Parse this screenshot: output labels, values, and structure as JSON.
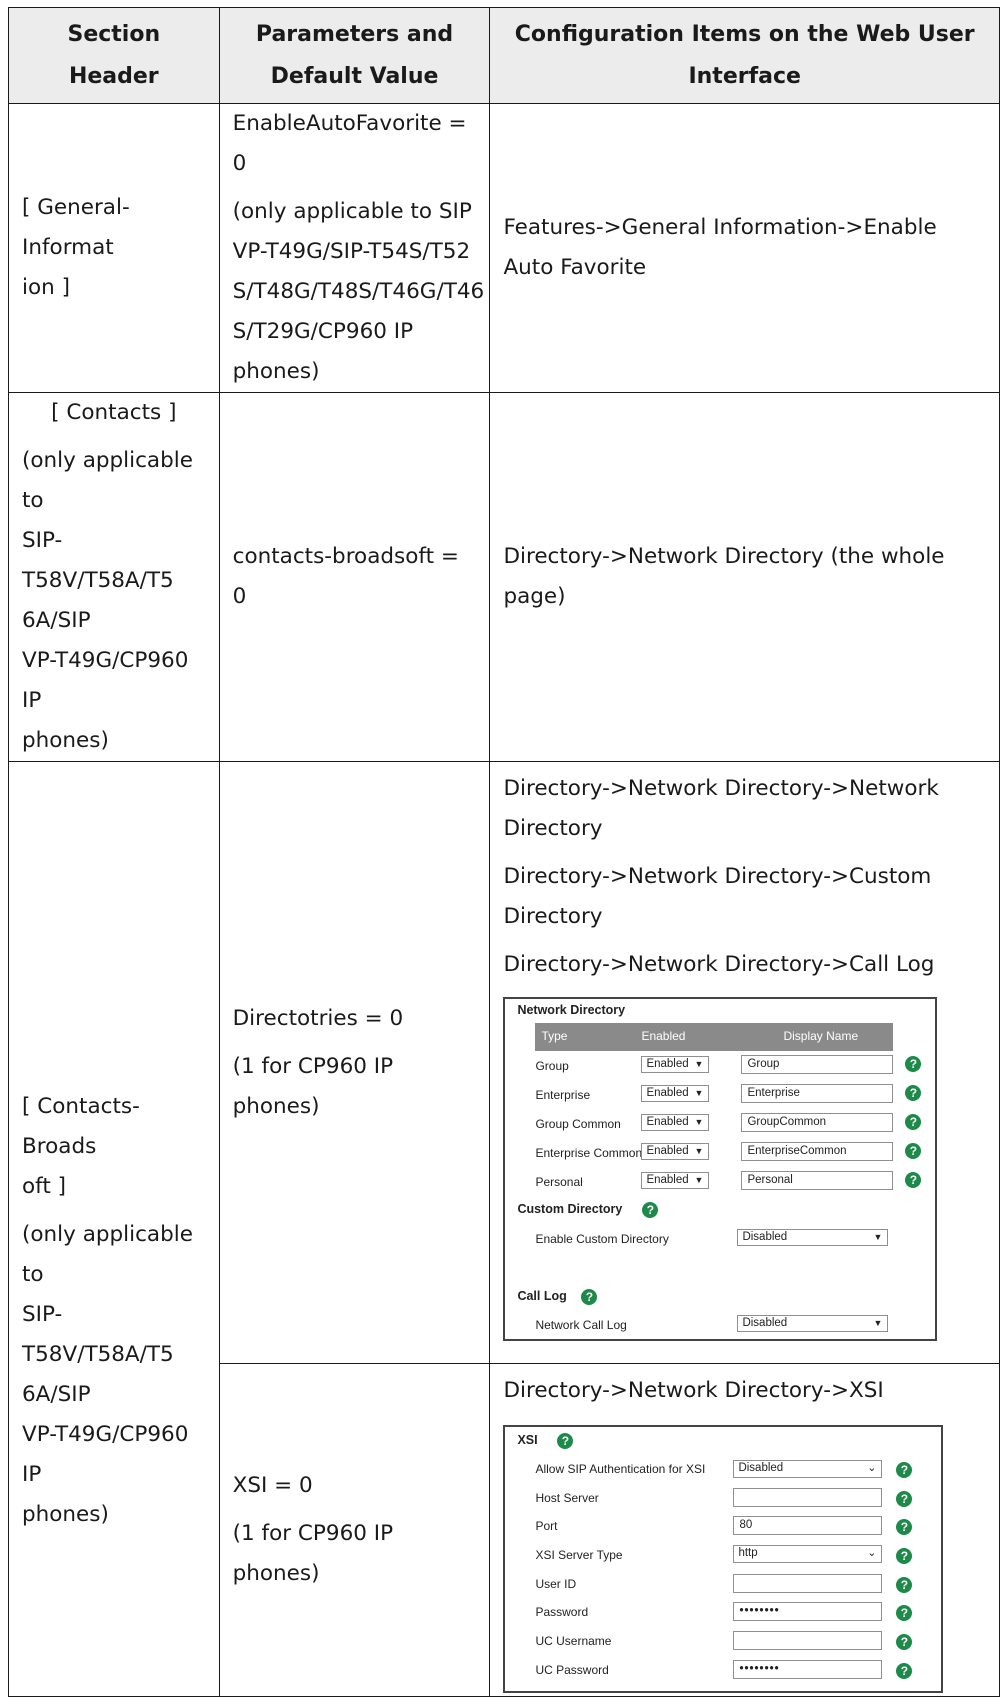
{
  "table": {
    "headers": {
      "section_header": "Section Header",
      "parameters_line1": "Parameters and",
      "parameters_line2": "Default Value",
      "config_line1": "Configuration Items on the Web User",
      "config_line2": "Interface"
    },
    "rows": [
      {
        "section_line1": "[ General-Informat",
        "section_line2": "ion ]",
        "param_line1": "EnableAutoFavorite = 0",
        "param_line2": "(only applicable to SIP",
        "param_line3": "VP-T49G/SIP-T54S/T52",
        "param_line4": "S/T48G/T48S/T46G/T46",
        "param_line5": "S/T29G/CP960 IP",
        "param_line6": "phones)",
        "config_line1": "Features->General Information->Enable",
        "config_line2": "Auto Favorite"
      },
      {
        "section_line1": "[ Contacts ]",
        "section_line2": "(only applicable to",
        "section_line3": "SIP-T58V/T58A/T5",
        "section_line4": "6A/SIP",
        "section_line5": "VP-T49G/CP960 IP",
        "section_line6": "phones)",
        "param_line1": "contacts-broadsoft = 0",
        "config_line1": "Directory->Network Directory (the whole",
        "config_line2": "page)"
      },
      {
        "section_line1": "[ Contacts-Broads",
        "section_line2": "oft ]",
        "section_line3": "(only applicable to",
        "section_line4": "SIP-T58V/T58A/T5",
        "section_line5": "6A/SIP",
        "section_line6": "VP-T49G/CP960 IP",
        "section_line7": "phones)",
        "param_a_line1": "Directotries = 0",
        "param_a_line2": "(1 for CP960 IP phones)",
        "config_a_line1": "Directory->Network Directory->Network",
        "config_a_line2": "Directory",
        "config_a_line3": "Directory->Network Directory->Custom",
        "config_a_line4": "Directory",
        "config_a_line5": "Directory->Network Directory->Call Log",
        "param_b_line1": "XSI = 0",
        "param_b_line2": "(1 for CP960 IP phones)",
        "config_b_line1": "Directory->Network Directory->XSI"
      }
    ]
  },
  "network_panel": {
    "title": "Network Directory",
    "columns": {
      "type": "Type",
      "enabled": "Enabled",
      "display_name": "Display Name"
    },
    "rows": [
      {
        "type": "Group",
        "enabled": "Enabled",
        "display_name": "Group"
      },
      {
        "type": "Enterprise",
        "enabled": "Enabled",
        "display_name": "Enterprise"
      },
      {
        "type": "Group Common",
        "enabled": "Enabled",
        "display_name": "GroupCommon"
      },
      {
        "type": "Enterprise Common",
        "enabled": "Enabled",
        "display_name": "EnterpriseCommon"
      },
      {
        "type": "Personal",
        "enabled": "Enabled",
        "display_name": "Personal"
      }
    ],
    "custom_title": "Custom Directory",
    "custom_label": "Enable Custom Directory",
    "custom_value": "Disabled",
    "calllog_title": "Call Log",
    "calllog_label": "Network Call Log",
    "calllog_value": "Disabled"
  },
  "xsi_panel": {
    "title": "XSI",
    "fields": [
      {
        "label": "Allow SIP Authentication for XSI",
        "value": "Disabled"
      },
      {
        "label": "Host Server",
        "value": ""
      },
      {
        "label": "Port",
        "value": "80"
      },
      {
        "label": "XSI Server Type",
        "value": "http"
      },
      {
        "label": "User ID",
        "value": ""
      },
      {
        "label": "Password",
        "value": "••••••••"
      },
      {
        "label": "UC Username",
        "value": ""
      },
      {
        "label": "UC Password",
        "value": "••••••••"
      }
    ]
  },
  "icons": {
    "help": "help-icon",
    "dropdown": "dropdown-arrow-icon"
  },
  "colors": {
    "help_icon": "#1e8a4a",
    "table_header_bg": "#ececec",
    "panel_header_bg": "#8a8a8a"
  }
}
